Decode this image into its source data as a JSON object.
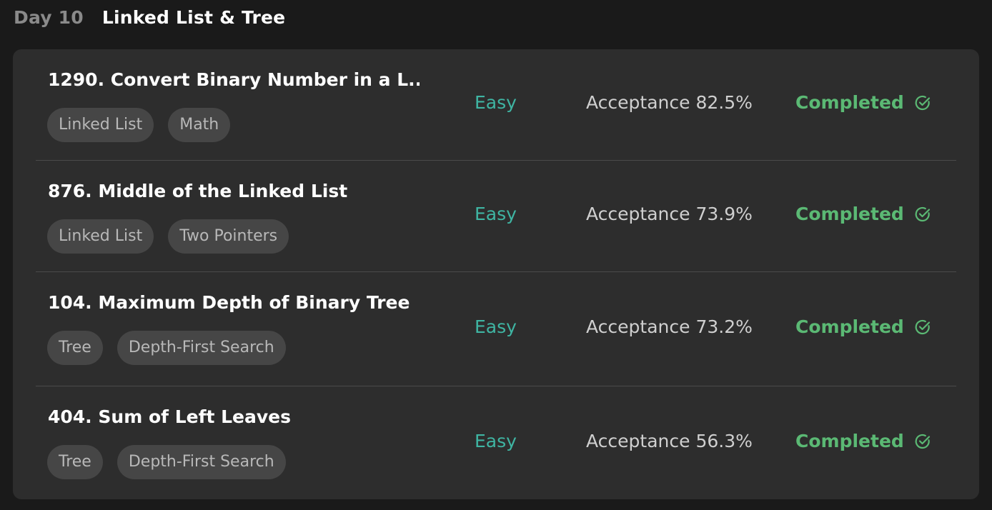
{
  "header": {
    "day": "Day 10",
    "title": "Linked List & Tree"
  },
  "colors": {
    "easy": "#3fb5a3",
    "completed": "#5bb974",
    "background": "#1a1a1a",
    "card": "#2d2d2d",
    "tag": "#464646"
  },
  "problems": [
    {
      "title": "1290. Convert Binary Number in a L...",
      "tags": [
        "Linked List",
        "Math"
      ],
      "difficulty": "Easy",
      "acceptance": "Acceptance 82.5%",
      "status": "Completed",
      "status_icon": "check-circle-icon"
    },
    {
      "title": "876. Middle of the Linked List",
      "tags": [
        "Linked List",
        "Two Pointers"
      ],
      "difficulty": "Easy",
      "acceptance": "Acceptance 73.9%",
      "status": "Completed",
      "status_icon": "check-circle-icon"
    },
    {
      "title": "104. Maximum Depth of Binary Tree",
      "tags": [
        "Tree",
        "Depth-First Search"
      ],
      "difficulty": "Easy",
      "acceptance": "Acceptance 73.2%",
      "status": "Completed",
      "status_icon": "check-circle-icon"
    },
    {
      "title": "404. Sum of Left Leaves",
      "tags": [
        "Tree",
        "Depth-First Search"
      ],
      "difficulty": "Easy",
      "acceptance": "Acceptance 56.3%",
      "status": "Completed",
      "status_icon": "check-circle-icon"
    }
  ]
}
